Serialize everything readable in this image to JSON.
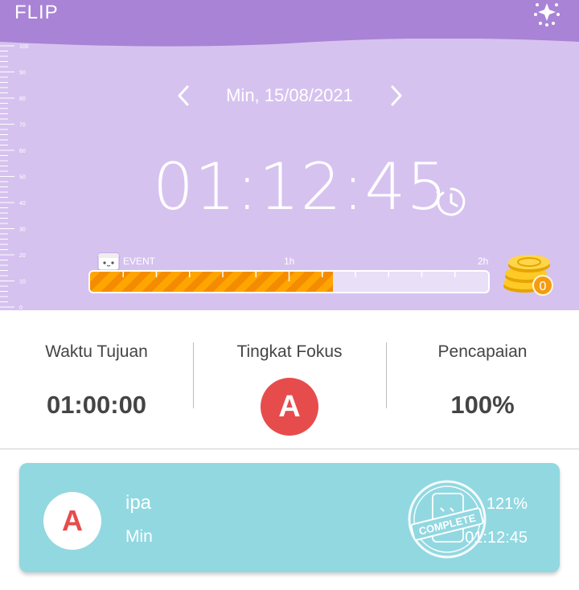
{
  "app": {
    "title": "FLIP"
  },
  "ruler": {
    "labels": [
      "100",
      "90",
      "80",
      "70",
      "60",
      "50",
      "40",
      "30",
      "20",
      "10",
      "0"
    ]
  },
  "date_nav": {
    "label": "Min, 15/08/2021",
    "prev_icon": "chevron-left-icon",
    "next_icon": "chevron-right-icon"
  },
  "timer": {
    "elapsed": "01:12:45",
    "icon": "timer-icon"
  },
  "progress": {
    "event_label": "EVENT",
    "mark_1h": "1h",
    "mark_2h": "2h",
    "fraction": 0.61,
    "coins": "0",
    "coin_icon": "coin-stack-icon"
  },
  "stats": {
    "target": {
      "label": "Waktu Tujuan",
      "value": "01:00:00"
    },
    "focus": {
      "label": "Tingkat Fokus",
      "grade": "A"
    },
    "achievement": {
      "label": "Pencapaian",
      "value": "100%"
    }
  },
  "record": {
    "grade": "A",
    "subject": "ipa",
    "day": "Min",
    "stamp_text": "COMPLETE",
    "percent": "121%",
    "duration": "01:12:45"
  },
  "colors": {
    "header": "#a983d6",
    "panel": "#d6c2ef",
    "progress": "#ffa500",
    "grade": "#e74c4c",
    "card": "#92d8e1"
  }
}
